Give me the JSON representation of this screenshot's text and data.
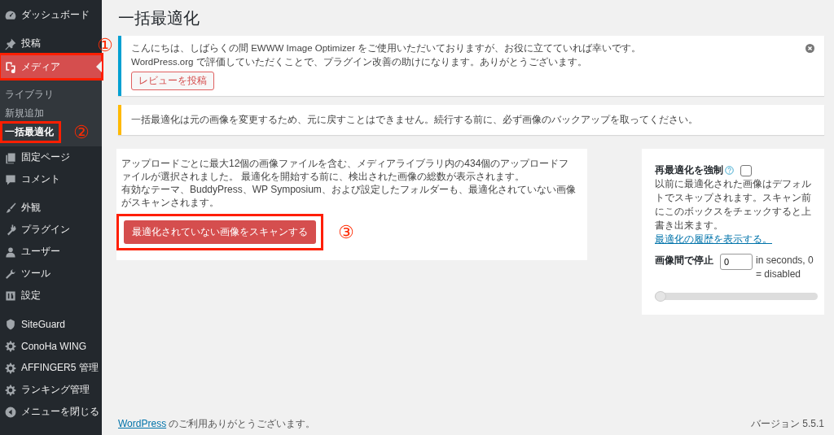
{
  "sidebar": {
    "sections": [
      [
        {
          "label": "ダッシュボード",
          "selected": false
        }
      ],
      [
        {
          "label": "投稿",
          "selected": false
        },
        {
          "label": "メディア",
          "selected": true,
          "highlighted": true,
          "callout": "①",
          "children": [
            {
              "label": "ライブラリ",
              "selected": false,
              "highlighted": false
            },
            {
              "label": "新規追加",
              "selected": false,
              "highlighted": false
            },
            {
              "label": "一括最適化",
              "selected": true,
              "highlighted": true,
              "callout": "②"
            }
          ]
        },
        {
          "label": "固定ページ",
          "selected": false
        },
        {
          "label": "コメント",
          "selected": false
        }
      ],
      [
        {
          "label": "外観",
          "selected": false
        },
        {
          "label": "プラグイン",
          "selected": false
        },
        {
          "label": "ユーザー",
          "selected": false
        },
        {
          "label": "ツール",
          "selected": false
        },
        {
          "label": "設定",
          "selected": false
        }
      ],
      [
        {
          "label": "SiteGuard",
          "selected": false
        },
        {
          "label": "ConoHa WING",
          "selected": false
        },
        {
          "label": "AFFINGER5 管理",
          "selected": false
        },
        {
          "label": "ランキング管理",
          "selected": false
        },
        {
          "label": "メニューを閉じる",
          "selected": false
        }
      ]
    ]
  },
  "page_title": "一括最適化",
  "notices": [
    {
      "kind": "info",
      "lines": [
        "こんにちは、しばらくの間 EWWW Image Optimizer をご使用いただいておりますが、お役に立てていれば幸いです。",
        "WordPress.org で評価していただくことで、プラグイン改善の助けになります。ありがとうございます。"
      ],
      "button": "レビューを投稿",
      "dismissible": true
    },
    {
      "kind": "warning",
      "lines": [
        "一括最適化は元の画像を変更するため、元に戻すことはできません。続行する前に、必ず画像のバックアップを取ってください。"
      ],
      "dismissible": false
    }
  ],
  "scan_panel": {
    "paragraphs": [
      "アップロードごとに最大12個の画像ファイルを含む、メディアライブラリ内の434個のアップロードファイルが選択されました。 最適化を開始する前に、検出された画像の総数が表示されます。",
      "有効なテーマ、BuddyPress、WP Symposium、および設定したフォルダーも、最適化されていない画像がスキャンされます。"
    ],
    "button": {
      "label": "最適化されていない画像をスキャンする",
      "highlighted": true,
      "callout": "③"
    }
  },
  "options_panel": {
    "force_label": "再最適化を強制",
    "force_checked": false,
    "force_text": "以前に最適化された画像はデフォルトでスキップされます。スキャン前にこのボックスをチェックすると上書き出来ます。",
    "history_link": "最適化の履歴を表示する。",
    "delay_label": "画像間で停止",
    "delay_value": "0",
    "delay_hint": "in seconds, 0 = disabled",
    "slider": {
      "level": 0
    }
  },
  "footer": {
    "link": "WordPress",
    "text": "のご利用ありがとうございます。",
    "version": "バージョン 5.5.1"
  }
}
